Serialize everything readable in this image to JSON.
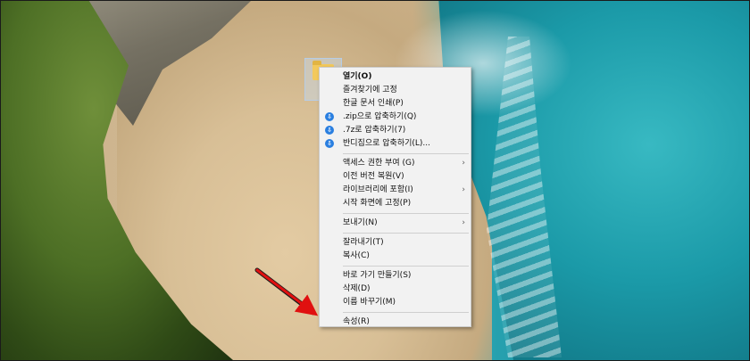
{
  "menu": {
    "items": [
      {
        "label": "열기(O)",
        "bold": true
      },
      {
        "label": "즐겨찾기에 고정"
      },
      {
        "label": "한글 문서 인쇄(P)"
      },
      {
        "label": ".zip으로 압축하기(Q)",
        "icon": "bandizip-icon"
      },
      {
        "label": ".7z로 압축하기(7)",
        "icon": "bandizip-icon"
      },
      {
        "label": "반디집으로 압축하기(L)...",
        "icon": "bandizip-icon"
      },
      {
        "separator": true
      },
      {
        "label": "액세스 권한 부여 (G)",
        "submenu": true
      },
      {
        "label": "이전 버전 복원(V)"
      },
      {
        "label": "라이브러리에 포함(I)",
        "submenu": true
      },
      {
        "label": "시작 화면에 고정(P)"
      },
      {
        "separator": true
      },
      {
        "label": "보내기(N)",
        "submenu": true
      },
      {
        "separator": true
      },
      {
        "label": "잘라내기(T)"
      },
      {
        "label": "복사(C)"
      },
      {
        "separator": true
      },
      {
        "label": "바로 가기 만들기(S)"
      },
      {
        "label": "삭제(D)"
      },
      {
        "label": "이름 바꾸기(M)"
      },
      {
        "separator": true
      },
      {
        "label": "속성(R)"
      }
    ]
  },
  "colors": {
    "menu_bg": "#f2f2f2",
    "arrow": "#e01010",
    "bandizip_icon": "#2a7fe0"
  },
  "icons": {
    "submenu": "chevron-right-icon",
    "desktop": "folder-icon"
  }
}
